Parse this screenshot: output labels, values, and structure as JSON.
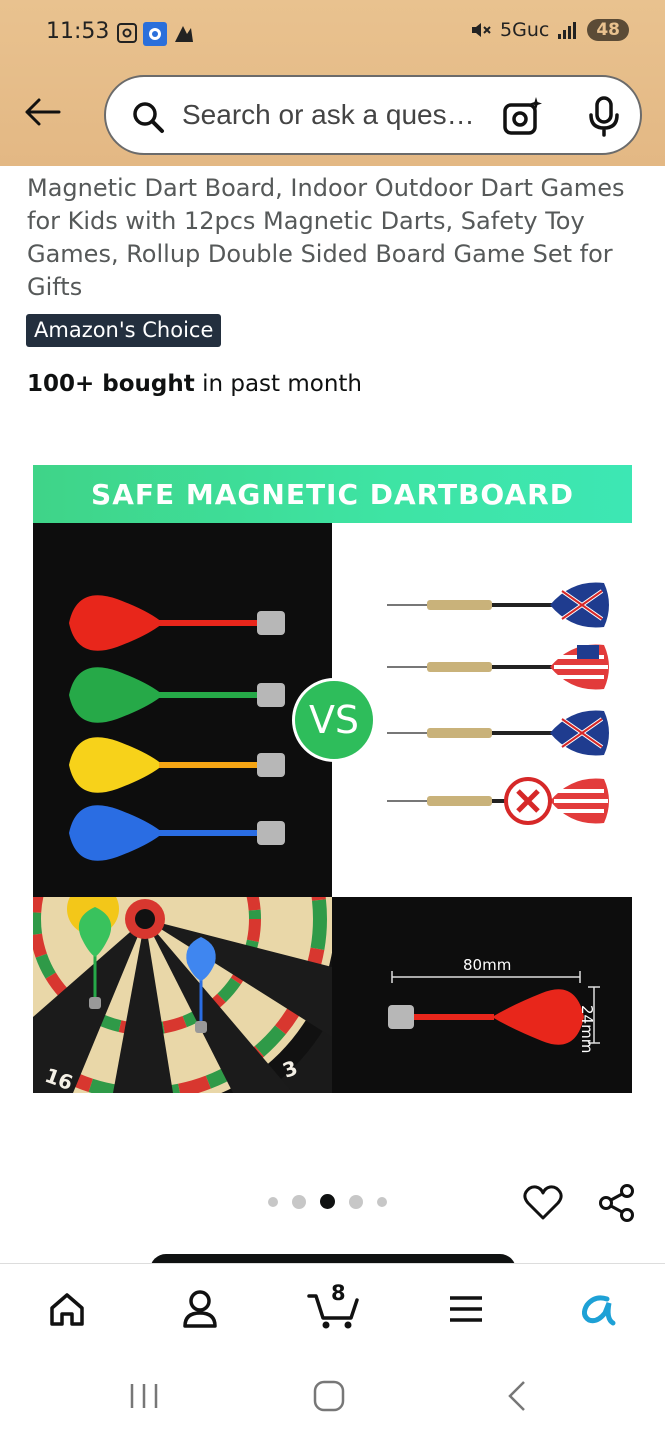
{
  "status_bar": {
    "time": "11:53",
    "network": "5Guc",
    "battery": "48"
  },
  "header": {
    "search_placeholder": "Search or ask a question"
  },
  "product": {
    "title": "Magnetic Dart Board, Indoor Outdoor Dart Games for Kids with 12pcs Magnetic Darts, Safety Toy Games, Rollup Double Sided Board Game Set for Gifts",
    "badge": "Amazon's Choice",
    "bought_bold": "100+ bought",
    "bought_rest": " in past month"
  },
  "image": {
    "banner": "SAFE MAGNETIC DARTBOARD",
    "vs": "VS",
    "length_label": "80mm",
    "width_label": "24mm",
    "board_numbers": [
      "16",
      "3"
    ]
  },
  "carousel": {
    "dots": 5,
    "active_index": 2
  },
  "bottom_nav": {
    "cart_count": "8",
    "items": [
      "home-icon",
      "account-icon",
      "cart-icon",
      "menu-icon",
      "rufus-icon"
    ]
  },
  "colors": {
    "header_bg": "#e6bd89",
    "badge_bg": "#232f3e",
    "banner_green": "#3fd488",
    "vs_green": "#2ebd5b",
    "rufus_blue": "#1ea1d6"
  }
}
